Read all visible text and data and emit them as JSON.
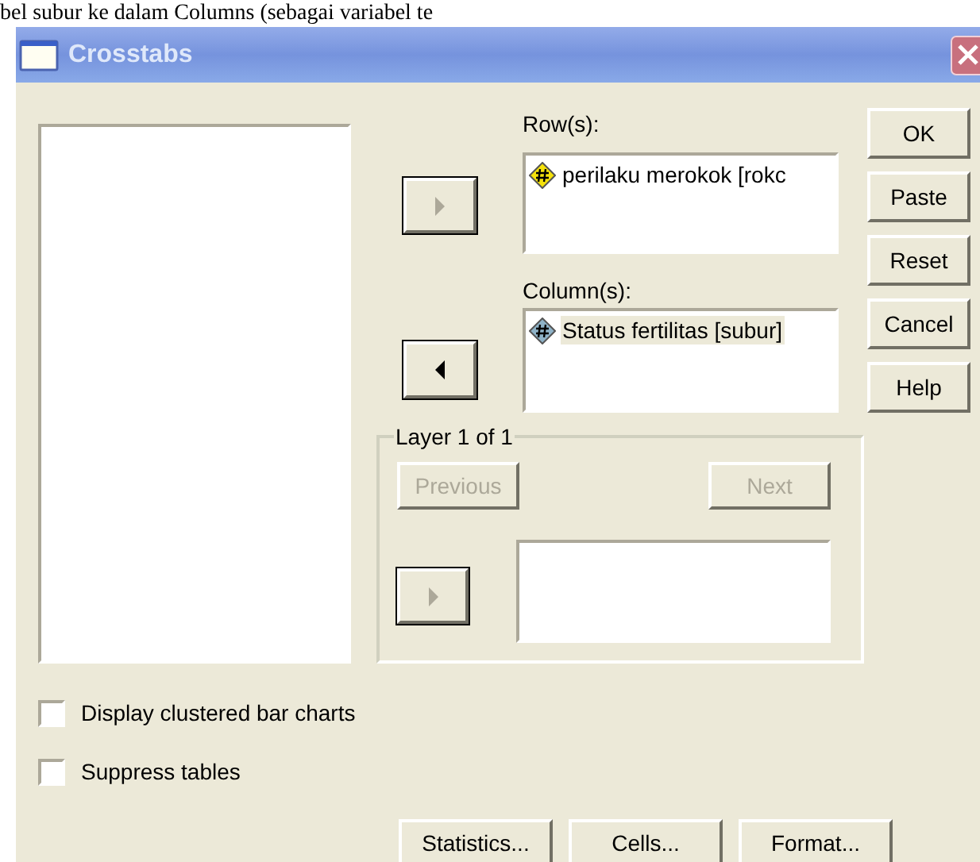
{
  "caption": "bel subur ke dalam Columns (sebagai variabel te",
  "window": {
    "title": "Crosstabs"
  },
  "rows": {
    "label": "Row(s):",
    "items": [
      {
        "text": "perilaku merokok [rokc",
        "kind": "ordinal",
        "selected": false
      }
    ]
  },
  "columns": {
    "label": "Column(s):",
    "items": [
      {
        "text": "Status fertilitas [subur]",
        "kind": "scale",
        "selected": true
      }
    ]
  },
  "move_buttons": [
    {
      "kind": "right",
      "disabled": true
    },
    {
      "kind": "left",
      "disabled": false
    }
  ],
  "buttons": [
    {
      "label": "OK"
    },
    {
      "label": "Paste"
    },
    {
      "label": "Reset"
    },
    {
      "label": "Cancel"
    },
    {
      "label": "Help"
    }
  ],
  "layer": {
    "title": "Layer 1 of 1",
    "previous": {
      "label": "Previous",
      "disabled": true
    },
    "next": {
      "label": "Next",
      "disabled": true
    },
    "move_button": {
      "kind": "right",
      "disabled": true
    }
  },
  "checkboxes": [
    {
      "label": "Display clustered bar charts",
      "checked": false
    },
    {
      "label": "Suppress tables",
      "checked": false
    }
  ],
  "bottom_buttons": [
    {
      "label": "Statistics..."
    },
    {
      "label": "Cells..."
    },
    {
      "label": "Format..."
    }
  ]
}
